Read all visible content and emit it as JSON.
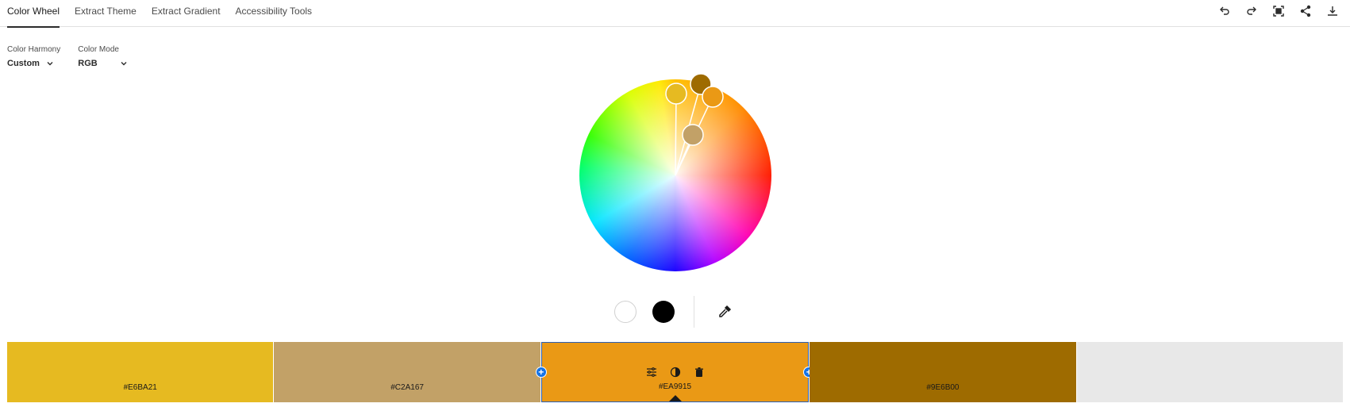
{
  "tabs": [
    {
      "label": "Color Wheel",
      "active": true
    },
    {
      "label": "Extract Theme",
      "active": false
    },
    {
      "label": "Extract Gradient",
      "active": false
    },
    {
      "label": "Accessibility Tools",
      "active": false
    }
  ],
  "toolbar": {
    "icons": [
      "undo-icon",
      "redo-icon",
      "fullscreen-icon",
      "share-icon",
      "download-icon"
    ]
  },
  "controls": {
    "harmony_label": "Color Harmony",
    "harmony_value": "Custom",
    "mode_label": "Color Mode",
    "mode_value": "RGB"
  },
  "swatches": [
    {
      "hex": "#E6BA21",
      "color": "#E6BA21"
    },
    {
      "hex": "#C2A167",
      "color": "#C2A167"
    },
    {
      "hex": "#EA9915",
      "color": "#EA9915",
      "selected": true
    },
    {
      "hex": "#9E6B00",
      "color": "#9E6B00"
    },
    {
      "hex": "",
      "color": "#E8E8E8"
    }
  ],
  "colors": {
    "accent": "#1473E6",
    "selected_border": "#2B5FB3"
  }
}
